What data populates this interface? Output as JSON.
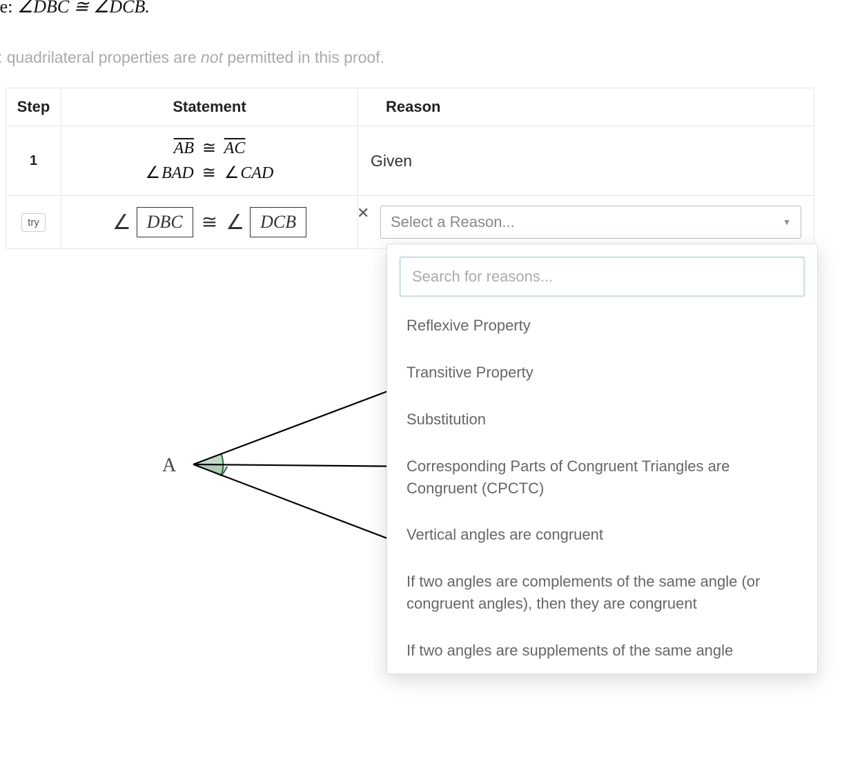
{
  "prove_line_prefix": "rove: ",
  "prove_rel": "∠DBC ≅ ∠DCB.",
  "note_prefix": "ote: quadrilateral properties are ",
  "note_em": "not",
  "note_suffix": " permitted in this proof.",
  "table": {
    "headers": {
      "step": "Step",
      "statement": "Statement",
      "reason": "Reason"
    },
    "row1": {
      "step": "1",
      "stmt_line1_left": "AB",
      "stmt_line1_rel": "≅",
      "stmt_line1_right": "AC",
      "stmt_line2_left": "BAD",
      "stmt_line2_rel": "≅",
      "stmt_line2_right": "CAD",
      "reason": "Given"
    },
    "row2": {
      "try_label": "try",
      "input1": "DBC",
      "rel": "≅",
      "input2": "DCB",
      "close": "✕",
      "select_placeholder": "Select a Reason..."
    }
  },
  "dropdown": {
    "search_placeholder": "Search for reasons...",
    "items": [
      "Reflexive Property",
      "Transitive Property",
      "Substitution",
      "Corresponding Parts of Congruent Triangles are Congruent (CPCTC)",
      "Vertical angles are congruent",
      "If two angles are complements of the same angle (or congruent angles), then they are congruent",
      "If two angles are supplements of the same angle"
    ]
  },
  "diagram": {
    "vertex_A": "A"
  }
}
